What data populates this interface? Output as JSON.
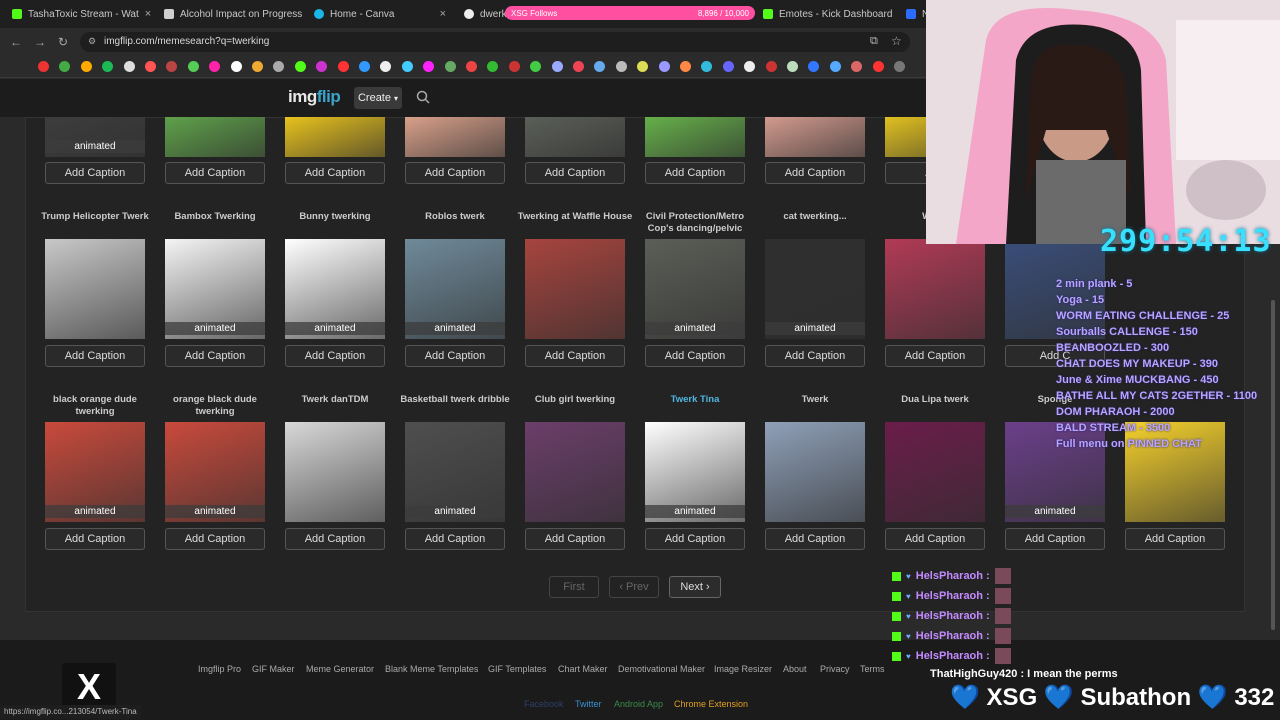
{
  "tabs": [
    {
      "label": "TashaToxic Stream - Wat",
      "color": "#53fc18"
    },
    {
      "label": "Alcohol Impact on Progress",
      "color": "#cfcfcf"
    },
    {
      "label": "Home - Canva",
      "color": "#19b6e8"
    },
    {
      "label": "dwerk g",
      "color": "#eeeeee"
    },
    {
      "label": "Emotes - Kick Dashboard",
      "color": "#53fc18"
    },
    {
      "label": "N",
      "color": "#2b6cff"
    }
  ],
  "browser": {
    "url": "imgflip.com/memesearch?q=twerking"
  },
  "follows_bar": {
    "label": "XSG Follows",
    "value": "8,896 / 10,000"
  },
  "site": {
    "logo_main": "img",
    "logo_accent": "flip",
    "create_label": "Create"
  },
  "rows": [
    {
      "items": [
        {
          "title": "",
          "animated": true,
          "caption": "Add Caption"
        },
        {
          "title": "",
          "animated": false,
          "caption": "Add Caption"
        },
        {
          "title": "",
          "animated": false,
          "caption": "Add Caption"
        },
        {
          "title": "",
          "animated": false,
          "caption": "Add Caption"
        },
        {
          "title": "",
          "animated": false,
          "caption": "Add Caption"
        },
        {
          "title": "",
          "animated": false,
          "caption": "Add Caption"
        },
        {
          "title": "",
          "animated": false,
          "caption": "Add Caption"
        },
        {
          "title": "",
          "animated": false,
          "caption": "Add"
        }
      ]
    },
    {
      "items": [
        {
          "title": "Trump Helicopter Twerk",
          "animated": false,
          "caption": "Add Caption"
        },
        {
          "title": "Bambox Twerking",
          "animated": true,
          "caption": "Add Caption"
        },
        {
          "title": "Bunny twerking",
          "animated": true,
          "caption": "Add Caption"
        },
        {
          "title": "Roblos twerk",
          "animated": true,
          "caption": "Add Caption"
        },
        {
          "title": "Twerking at Waffle House",
          "animated": false,
          "caption": "Add Caption"
        },
        {
          "title": "Civil Protection/Metro Cop's dancing/pelvic",
          "animated": true,
          "caption": "Add Caption"
        },
        {
          "title": "cat twerking...",
          "animated": true,
          "caption": "Add Caption"
        },
        {
          "title": "White",
          "animated": false,
          "caption": "Add Caption"
        },
        {
          "title": "",
          "animated": false,
          "caption": "Add C"
        }
      ]
    },
    {
      "items": [
        {
          "title": "black orange dude twerking",
          "animated": true,
          "caption": "Add Caption"
        },
        {
          "title": "orange black dude twerking",
          "animated": true,
          "caption": "Add Caption"
        },
        {
          "title": "Twerk danTDM",
          "animated": false,
          "caption": "Add Caption"
        },
        {
          "title": "Basketball twerk dribble",
          "animated": true,
          "caption": "Add Caption"
        },
        {
          "title": "Club girl twerking",
          "animated": false,
          "caption": "Add Caption"
        },
        {
          "title": "Twerk Tina",
          "animated": true,
          "caption": "Add Caption"
        },
        {
          "title": "Twerk",
          "animated": false,
          "caption": "Add Caption"
        },
        {
          "title": "Dua Lipa twerk",
          "animated": false,
          "caption": "Add Caption"
        },
        {
          "title": "Sponge",
          "animated": true,
          "caption": "Add Caption"
        },
        {
          "title": "",
          "animated": false,
          "caption": "Add Caption"
        }
      ]
    }
  ],
  "animated_label": "animated",
  "pagination": {
    "first": "First",
    "prev": "‹ Prev",
    "next": "Next ›"
  },
  "footer": {
    "links": [
      "Imgflip Pro",
      "GIF Maker",
      "Meme Generator",
      "Blank Meme Templates",
      "GIF Templates",
      "Chart Maker",
      "Demotivational Maker",
      "Image Resizer",
      "About",
      "Privacy",
      "Terms"
    ],
    "links2": [
      "Facebook",
      "Twitter",
      "Android App",
      "Chrome Extension"
    ],
    "status_url": "https://imgflip.co...213054/Twerk-Tina"
  },
  "stream": {
    "timer": "299:54:13",
    "menu": [
      "2 min plank - 5",
      "Yoga - 15",
      "WORM EATING CHALLENGE - 25",
      "Sourballs CALLENGE - 150",
      "BEANBOOZLED - 300",
      "CHAT DOES MY MAKEUP - 390",
      "June & Xime MUCKBANG - 450",
      "BATHE ALL MY CATS 2GETHER - 1100",
      "DOM PHARAOH - 2000",
      "BALD STREAM - 3500",
      "Full menu on PINNED CHAT"
    ],
    "chat_user": "HelsPharaoh :",
    "chat_last": "ThatHighGuy420 : I mean the perms",
    "subathon": "💙 XSG 💙 Subathon 💙 332 /"
  }
}
